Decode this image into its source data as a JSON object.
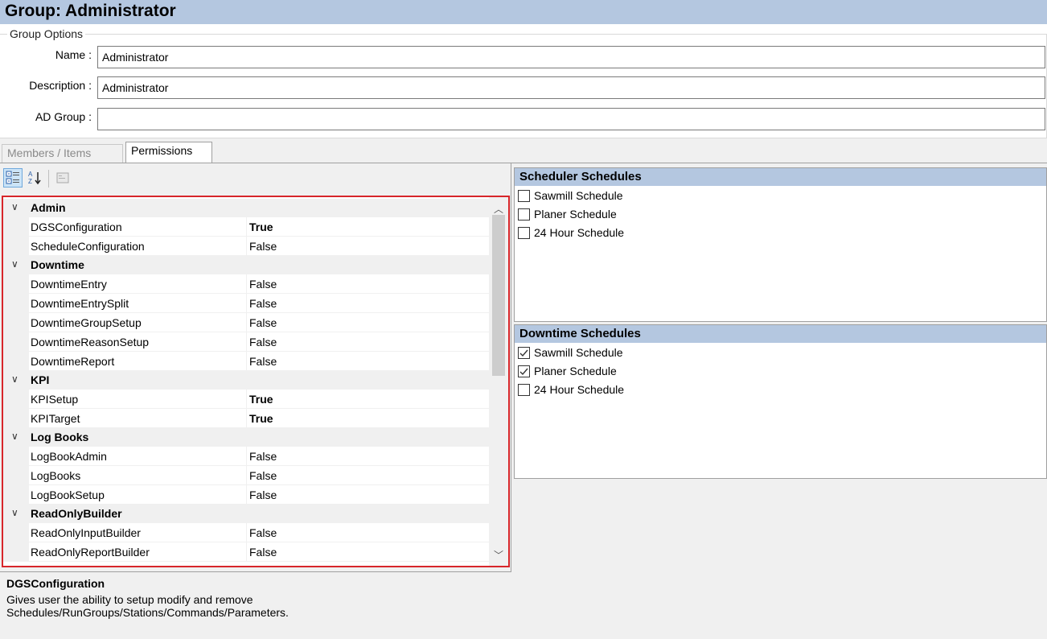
{
  "window": {
    "title": "Group: Administrator"
  },
  "group_options": {
    "legend": "Group Options",
    "name_label": "Name :",
    "name_value": "Administrator",
    "description_label": "Description :",
    "description_value": "Administrator",
    "ad_group_label": "AD Group :",
    "ad_group_value": ""
  },
  "tabs": [
    {
      "label": "Members / Items",
      "active": false
    },
    {
      "label": "Permissions",
      "active": true
    }
  ],
  "toolbar": {
    "categorized_icon": "categorized-view-icon",
    "alphabetical_icon": "alphabetical-sort-icon",
    "property_pages_icon": "property-pages-icon"
  },
  "property_grid": {
    "categories": [
      {
        "name": "Admin",
        "props": [
          {
            "name": "DGSConfiguration",
            "value": "True",
            "bold": true
          },
          {
            "name": "ScheduleConfiguration",
            "value": "False",
            "bold": false
          }
        ]
      },
      {
        "name": "Downtime",
        "props": [
          {
            "name": "DowntimeEntry",
            "value": "False",
            "bold": false
          },
          {
            "name": "DowntimeEntrySplit",
            "value": "False",
            "bold": false
          },
          {
            "name": "DowntimeGroupSetup",
            "value": "False",
            "bold": false
          },
          {
            "name": "DowntimeReasonSetup",
            "value": "False",
            "bold": false
          },
          {
            "name": "DowntimeReport",
            "value": "False",
            "bold": false
          }
        ]
      },
      {
        "name": "KPI",
        "props": [
          {
            "name": "KPISetup",
            "value": "True",
            "bold": true
          },
          {
            "name": "KPITarget",
            "value": "True",
            "bold": true
          }
        ]
      },
      {
        "name": "Log Books",
        "props": [
          {
            "name": "LogBookAdmin",
            "value": "False",
            "bold": false
          },
          {
            "name": "LogBooks",
            "value": "False",
            "bold": false
          },
          {
            "name": "LogBookSetup",
            "value": "False",
            "bold": false
          }
        ]
      },
      {
        "name": "ReadOnlyBuilder",
        "props": [
          {
            "name": "ReadOnlyInputBuilder",
            "value": "False",
            "bold": false
          },
          {
            "name": "ReadOnlyReportBuilder",
            "value": "False",
            "bold": false
          }
        ]
      }
    ]
  },
  "help": {
    "title": "DGSConfiguration",
    "description": "Gives user the ability to setup modify and remove Schedules/RunGroups/Stations/Commands/Parameters."
  },
  "scheduler_schedules": {
    "title": "Scheduler Schedules",
    "items": [
      {
        "label": "Sawmill Schedule",
        "checked": false
      },
      {
        "label": "Planer Schedule",
        "checked": false
      },
      {
        "label": "24 Hour Schedule",
        "checked": false
      }
    ]
  },
  "downtime_schedules": {
    "title": "Downtime Schedules",
    "items": [
      {
        "label": "Sawmill Schedule",
        "checked": true
      },
      {
        "label": "Planer Schedule",
        "checked": true
      },
      {
        "label": "24 Hour Schedule",
        "checked": false
      }
    ]
  }
}
